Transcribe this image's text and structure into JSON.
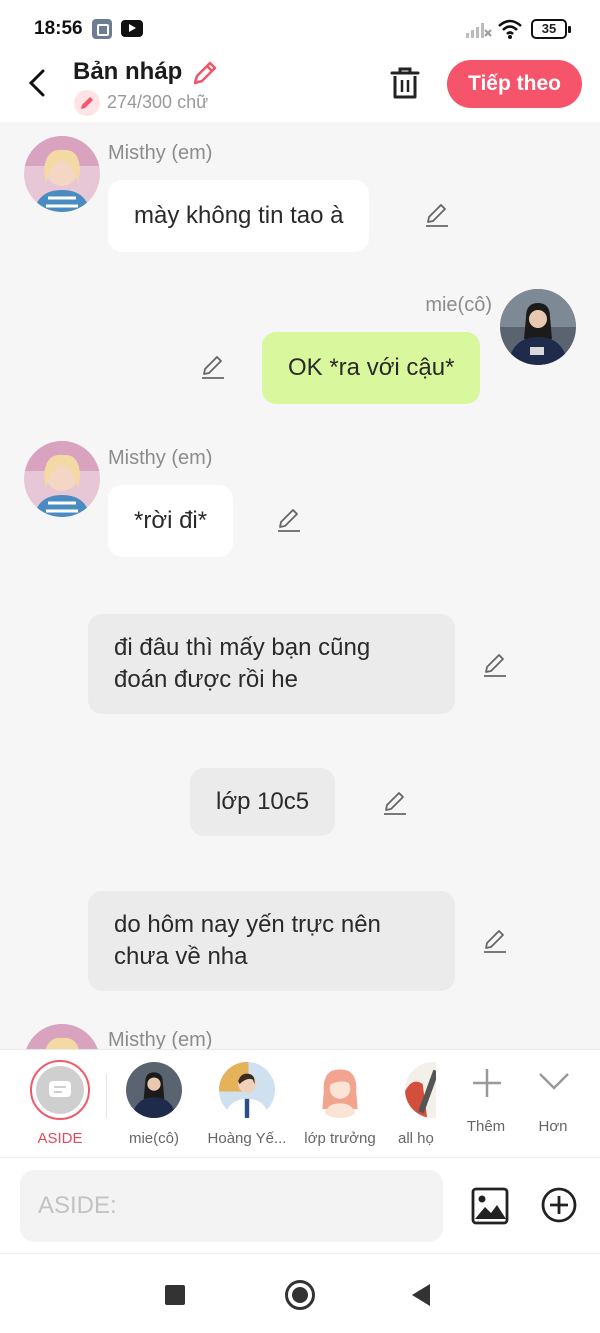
{
  "status_bar": {
    "time": "18:56",
    "battery": "35",
    "icons": [
      "gallery-icon",
      "youtube-icon",
      "signal-icon",
      "wifi-icon",
      "battery-icon"
    ]
  },
  "header": {
    "title": "Bản nháp",
    "word_count": "274/300 chữ",
    "next_label": "Tiếp theo"
  },
  "messages": [
    {
      "name": "Misthy (em)",
      "text": "mày không tin tao à",
      "side": "left"
    },
    {
      "name": "mie(cô)",
      "text": "OK *ra với cậu*",
      "side": "right"
    },
    {
      "name": "Misthy (em)",
      "text": "*rời đi*",
      "side": "left"
    },
    {
      "line1": "đi đâu thì mấy bạn cũng",
      "line2": "đoán được rồi he",
      "side": "narration"
    },
    {
      "text": "lớp 10c5",
      "side": "narration"
    },
    {
      "line1": "do hôm nay yến trực nên",
      "line2": "chưa về nha",
      "side": "narration"
    },
    {
      "name": "Misthy (em)",
      "side": "left"
    }
  ],
  "characters": [
    {
      "label": "ASIDE"
    },
    {
      "label": "mie(cô)"
    },
    {
      "label": "Hoàng Yế..."
    },
    {
      "label": "lớp trưởng"
    },
    {
      "label": "all họ"
    },
    {
      "label": "Thêm"
    },
    {
      "label": "Hơn"
    }
  ],
  "input": {
    "placeholder": "ASIDE:"
  },
  "colors": {
    "accent": "#f5546a",
    "user_bubble": "#d9f79c",
    "bg": "#f6f6f6"
  }
}
